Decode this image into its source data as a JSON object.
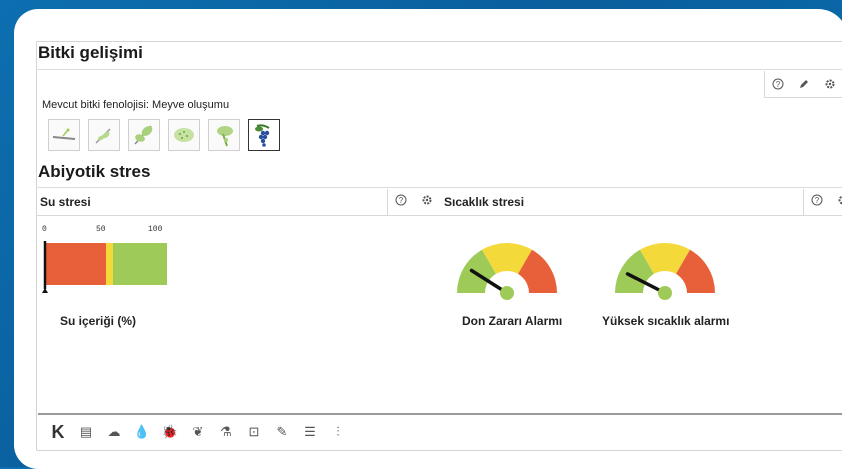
{
  "title": "Bitki gelişimi",
  "phenology": {
    "label": "Mevcut bitki fenolojisi: Meyve oluşumu",
    "stages": [
      {
        "icon": "seedling-branch-icon",
        "active": false
      },
      {
        "icon": "leaf-sprout-icon",
        "active": false
      },
      {
        "icon": "leaves-icon",
        "active": false
      },
      {
        "icon": "flowering-icon",
        "active": false
      },
      {
        "icon": "bunch-closure-icon",
        "active": false
      },
      {
        "icon": "grape-cluster-icon",
        "active": true
      }
    ]
  },
  "top_tools": [
    "help-icon",
    "edit-icon",
    "settings-icon"
  ],
  "abiotic": {
    "title": "Abiyotik stres",
    "water": {
      "label": "Su stresi",
      "tools": [
        "help-icon",
        "settings-icon"
      ],
      "scale": [
        "0",
        "50",
        "100"
      ],
      "caption": "Su içeriği (%)",
      "value": 1
    },
    "temperature": {
      "label": "Sıcaklık stresi",
      "tools": [
        "help-icon",
        "settings-icon"
      ],
      "gauges": [
        {
          "caption": "Don Zararı Alarmı",
          "level": 0.18
        },
        {
          "caption": "Yüksek sıcaklık alarmı",
          "level": 0.15
        }
      ]
    }
  },
  "colors": {
    "green": "#9ecb58",
    "yellow": "#f3d93a",
    "red": "#e8603a",
    "needle": "#111111",
    "accent": "#1a5fb4"
  },
  "bottom_toolbar": [
    {
      "icon": "k-icon",
      "glyph": "K"
    },
    {
      "icon": "document-icon",
      "glyph": "▤"
    },
    {
      "icon": "cloud-icon",
      "glyph": "☁"
    },
    {
      "icon": "drop-icon",
      "glyph": "💧"
    },
    {
      "icon": "bug-icon",
      "glyph": "🐞"
    },
    {
      "icon": "leaf-icon",
      "glyph": "❦"
    },
    {
      "icon": "flask-icon",
      "glyph": "⚗"
    },
    {
      "icon": "frame-icon",
      "glyph": "⊡"
    },
    {
      "icon": "notes-icon",
      "glyph": "✎"
    },
    {
      "icon": "list-icon",
      "glyph": "☰"
    },
    {
      "icon": "sliders-icon",
      "glyph": "⫶"
    }
  ]
}
